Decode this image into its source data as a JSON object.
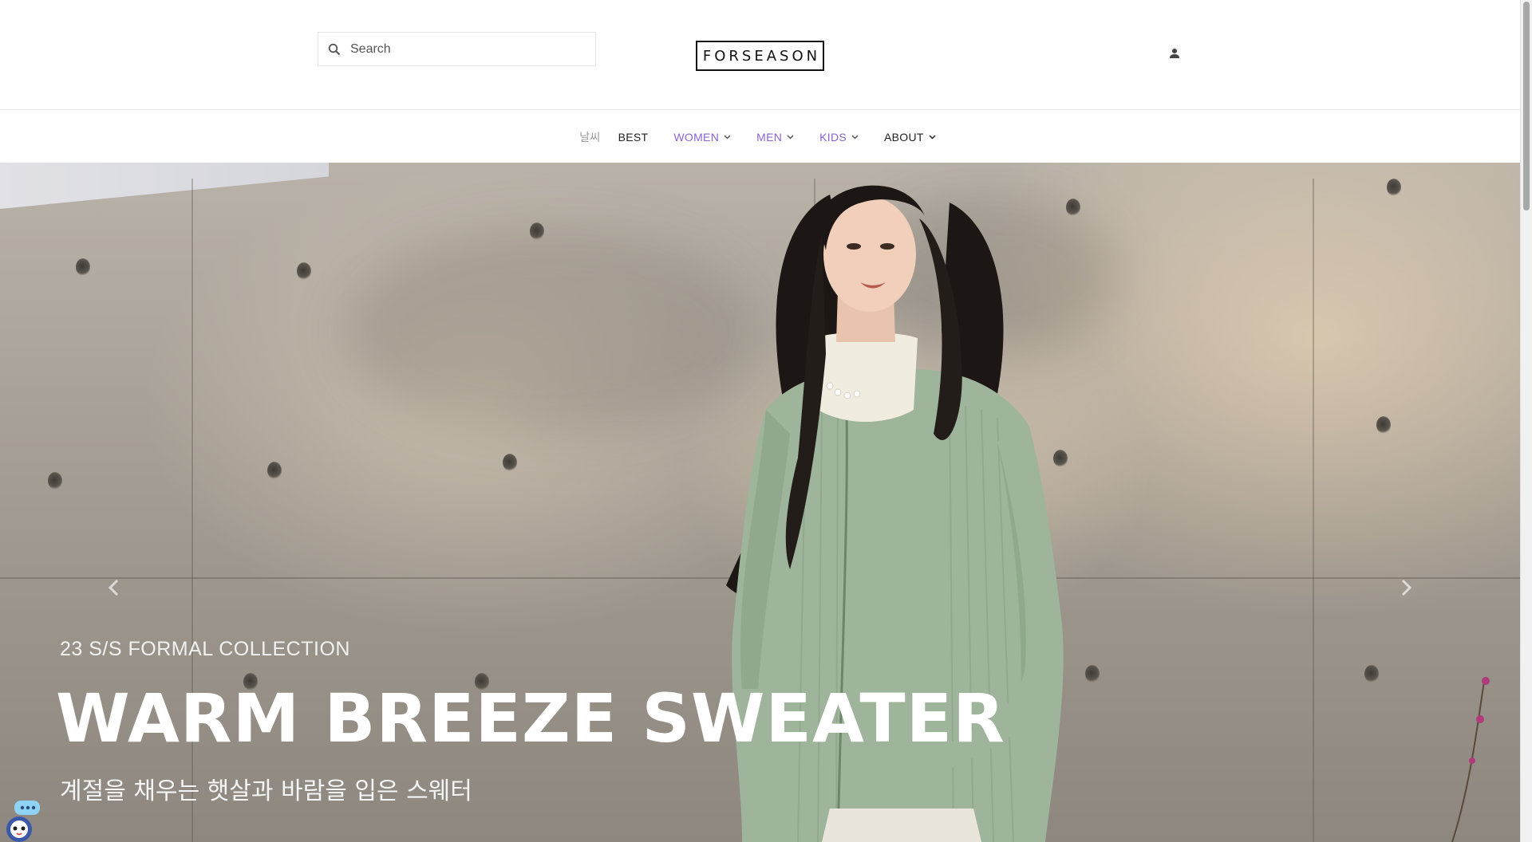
{
  "header": {
    "search": {
      "placeholder": "Search",
      "icon": "search-icon"
    },
    "logo": "FORSEASON",
    "account_icon": "person-icon"
  },
  "nav": {
    "items": [
      {
        "label": "날씨",
        "style": "weather"
      },
      {
        "label": "BEST",
        "style": "dark",
        "dropdown": false
      },
      {
        "label": "WOMEN",
        "style": "purple",
        "dropdown": true
      },
      {
        "label": "MEN",
        "style": "purple",
        "dropdown": true
      },
      {
        "label": "KIDS",
        "style": "purple",
        "dropdown": true
      },
      {
        "label": "ABOUT",
        "style": "dark",
        "dropdown": true
      }
    ]
  },
  "hero": {
    "subtitle": "23 S/S FORMAL COLLECTION",
    "title": "WARM BREEZE SWEATER",
    "description": "계절을 채우는 햇살과 바람을 입은 스웨터",
    "prev_icon": "chevron-left-icon",
    "next_icon": "chevron-right-icon"
  },
  "chatbot_icon": "chatbot-icon",
  "colors": {
    "nav_accent": "#8a63d2",
    "text_dark": "#222222",
    "hero_text": "#ffffff",
    "sweater": "#9fb59b"
  }
}
